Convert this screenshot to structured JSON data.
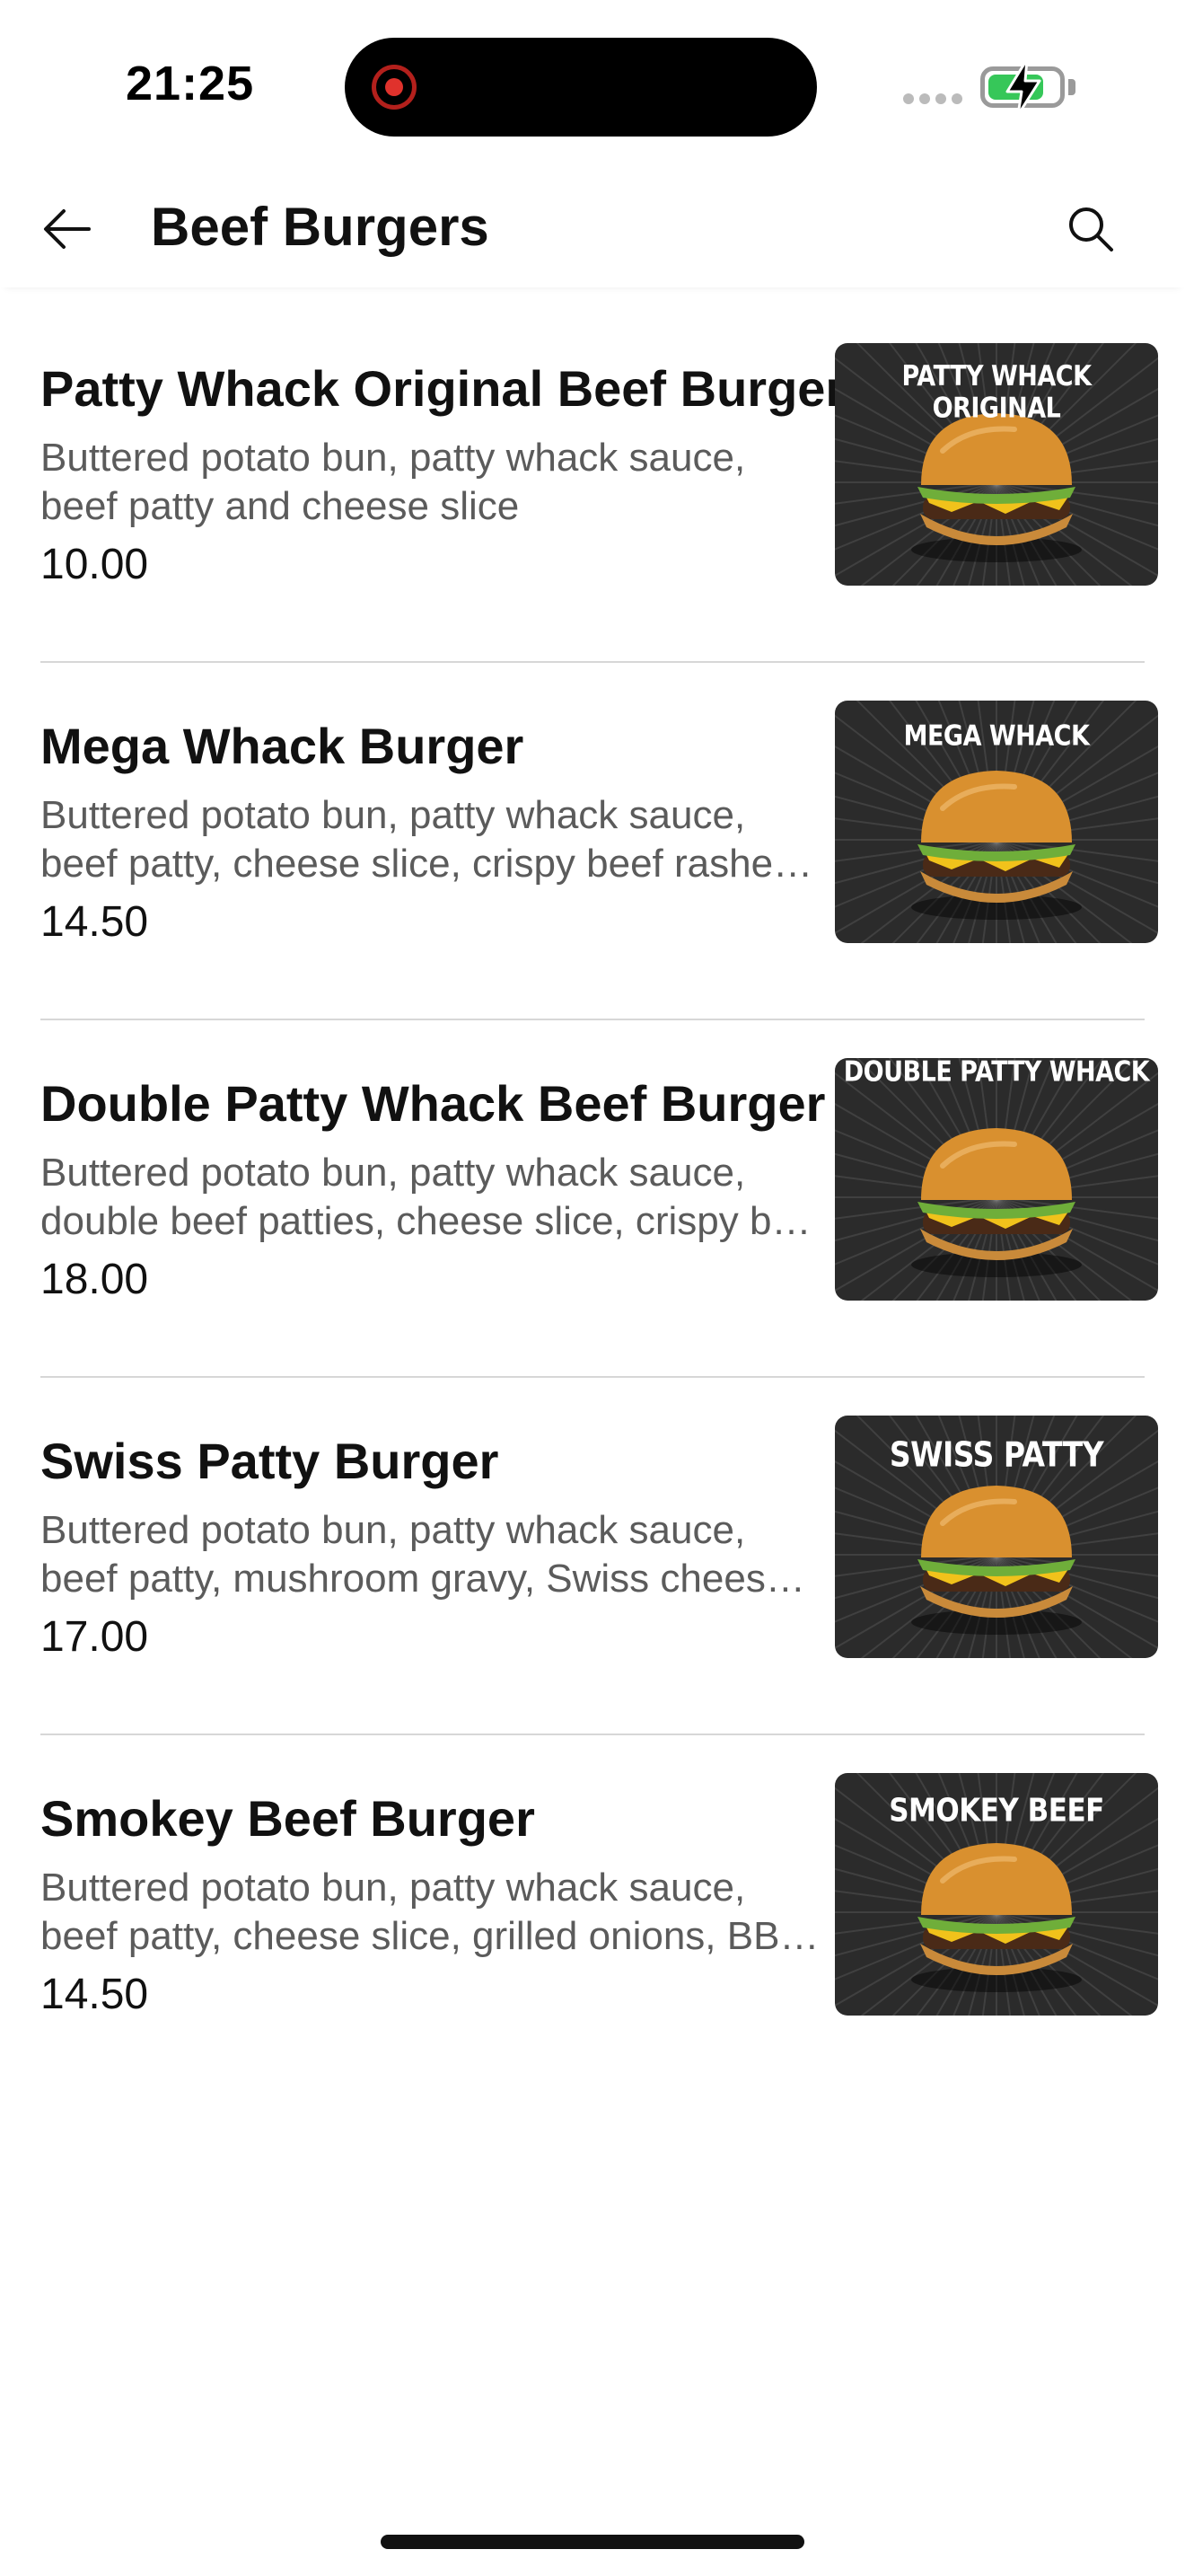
{
  "status_bar": {
    "time": "21:25",
    "battery_color": "#36c759",
    "battery_level": 0.8,
    "icons": [
      "recording-indicator-icon",
      "signal-dots-icon",
      "battery-charging-icon"
    ]
  },
  "header": {
    "title": "Beef Burgers",
    "back_icon": "arrow-left-icon",
    "search_icon": "search-icon"
  },
  "menu": {
    "items": [
      {
        "name": "Patty Whack Original Beef Burger",
        "desc_line1": "Buttered potato bun, patty whack sauce,",
        "desc_line2": "beef patty and cheese slice",
        "price": "10.00",
        "image_caption": "PATTY WHACK ORIGINAL"
      },
      {
        "name": "Mega Whack Burger",
        "desc_line1": "Buttered potato bun, patty whack sauce,",
        "desc_line2": "beef patty, cheese slice, crispy beef rasher…",
        "price": "14.50",
        "image_caption": "MEGA WHACK"
      },
      {
        "name": "Double Patty Whack Beef Burger",
        "desc_line1": "Buttered potato bun, patty whack sauce,",
        "desc_line2": "double beef patties, cheese slice, crispy be…",
        "price": "18.00",
        "image_caption": "DOUBLE PATTY WHACK"
      },
      {
        "name": "Swiss Patty Burger",
        "desc_line1": "Buttered potato bun, patty whack sauce,",
        "desc_line2": "beef patty, mushroom gravy, Swiss cheese…",
        "price": "17.00",
        "image_caption": "SWISS PATTY"
      },
      {
        "name": "Smokey Beef Burger",
        "desc_line1": "Buttered potato bun, patty whack sauce,",
        "desc_line2": "beef patty, cheese slice, grilled onions, BB…",
        "price": "14.50",
        "image_caption": "SMOKEY BEEF"
      }
    ]
  },
  "colors": {
    "text_primary": "#111111",
    "text_secondary": "#5b5b5b",
    "divider": "#d7d7d7",
    "image_background": "#2b2b2b"
  }
}
